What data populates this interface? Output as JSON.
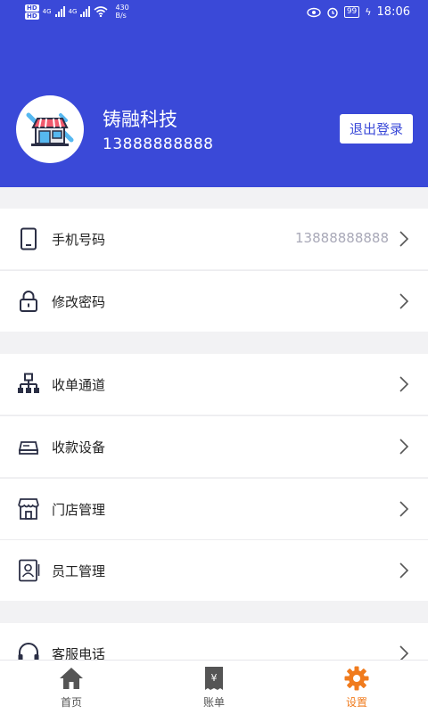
{
  "status_bar": {
    "hd1": "HD",
    "hd2": "HD",
    "net1": "4G",
    "net2": "4G",
    "speed_value": "430",
    "speed_unit": "B/s",
    "battery": "99",
    "time": "18:06"
  },
  "profile": {
    "company_name": "铸融科技",
    "phone": "13888888888",
    "logout_label": "退出登录"
  },
  "menu_groups": [
    [
      {
        "label": "手机号码",
        "value": "13888888888",
        "icon": "phone-icon"
      },
      {
        "label": "修改密码",
        "icon": "lock-icon"
      }
    ],
    [
      {
        "label": "收单通道",
        "icon": "channel-icon"
      },
      {
        "label": "收款设备",
        "icon": "device-icon"
      },
      {
        "label": "门店管理",
        "icon": "store-icon"
      },
      {
        "label": "员工管理",
        "icon": "staff-icon"
      }
    ],
    [
      {
        "label": "客服电话",
        "icon": "headset-icon"
      }
    ]
  ],
  "tabs": [
    {
      "label": "首页",
      "icon": "home-icon",
      "active": false
    },
    {
      "label": "账单",
      "icon": "bill-icon",
      "active": false
    },
    {
      "label": "设置",
      "icon": "settings-icon",
      "active": true
    }
  ],
  "colors": {
    "primary": "#3a49d8",
    "active_tab": "#f07b1d",
    "page_bg": "#f2f2f4"
  }
}
